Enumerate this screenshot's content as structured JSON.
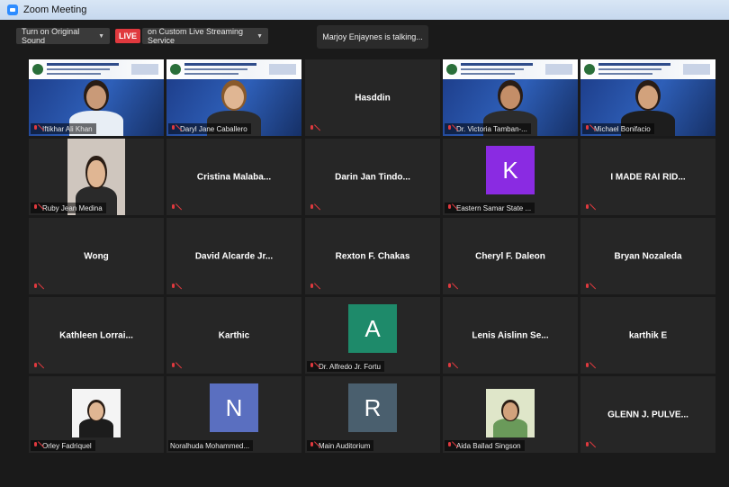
{
  "window": {
    "title": "Zoom Meeting"
  },
  "toolbar": {
    "original_sound": "Turn on Original Sound",
    "live_badge": "LIVE",
    "live_stream": "on Custom Live Streaming Service"
  },
  "status": {
    "talking": "Marjoy Enjaynes is talking..."
  },
  "tiles": [
    {
      "name": "Iftikhar Ali Khan",
      "label": "Iftikhar Ali Khan",
      "type": "video"
    },
    {
      "name": "Daryl Jane Caballero",
      "label": "Daryl Jane Caballero",
      "type": "video"
    },
    {
      "name": "Hasddin",
      "label": "",
      "type": "name"
    },
    {
      "name": "Dr. Victoria Tamban",
      "label": "Dr. Victoria Tamban-...",
      "type": "video"
    },
    {
      "name": "Michael Bonifacio",
      "label": "Michael Bonifacio",
      "type": "video"
    },
    {
      "name": "Ruby Jean Medina",
      "label": "Ruby Jean Medina",
      "type": "photo"
    },
    {
      "name": "Cristina Malaba...",
      "label": "",
      "type": "name"
    },
    {
      "name": "Darin Jan Tindo...",
      "label": "",
      "type": "name"
    },
    {
      "name": "Eastern Samar State ...",
      "label": "Eastern Samar State ...",
      "type": "letter",
      "letter": "K",
      "color": "#8a2be2"
    },
    {
      "name": "I MADE RAI RID...",
      "label": "",
      "type": "name"
    },
    {
      "name": "Wong",
      "label": "",
      "type": "name"
    },
    {
      "name": "David Alcarde Jr...",
      "label": "",
      "type": "name"
    },
    {
      "name": "Rexton F. Chakas",
      "label": "",
      "type": "name"
    },
    {
      "name": "Cheryl F. Daleon",
      "label": "",
      "type": "name"
    },
    {
      "name": "Bryan Nozaleda",
      "label": "",
      "type": "name"
    },
    {
      "name": "Kathleen Lorrai...",
      "label": "",
      "type": "name"
    },
    {
      "name": "Karthic",
      "label": "",
      "type": "name"
    },
    {
      "name": "Dr. Alfredo Jr. Fortu",
      "label": "Dr. Alfredo Jr. Fortu",
      "type": "letter",
      "letter": "A",
      "color": "#1e8a6a"
    },
    {
      "name": "Lenis Aislinn Se...",
      "label": "",
      "type": "name"
    },
    {
      "name": "karthik E",
      "label": "",
      "type": "name"
    },
    {
      "name": "Orley Fadriquel",
      "label": "Orley Fadriquel",
      "type": "photo"
    },
    {
      "name": "Noralhuda Mohammed...",
      "label": "Noralhuda Mohammed...",
      "type": "letter",
      "letter": "N",
      "color": "#5a6fc0",
      "nomic": true
    },
    {
      "name": "Main Auditorium",
      "label": "Main Auditorium",
      "type": "letter",
      "letter": "R",
      "color": "#4a5f6e"
    },
    {
      "name": "Aida Ballad Singson",
      "label": "Aida Ballad Singson",
      "type": "photo"
    },
    {
      "name": "GLENN J. PULVE...",
      "label": "",
      "type": "name"
    }
  ]
}
